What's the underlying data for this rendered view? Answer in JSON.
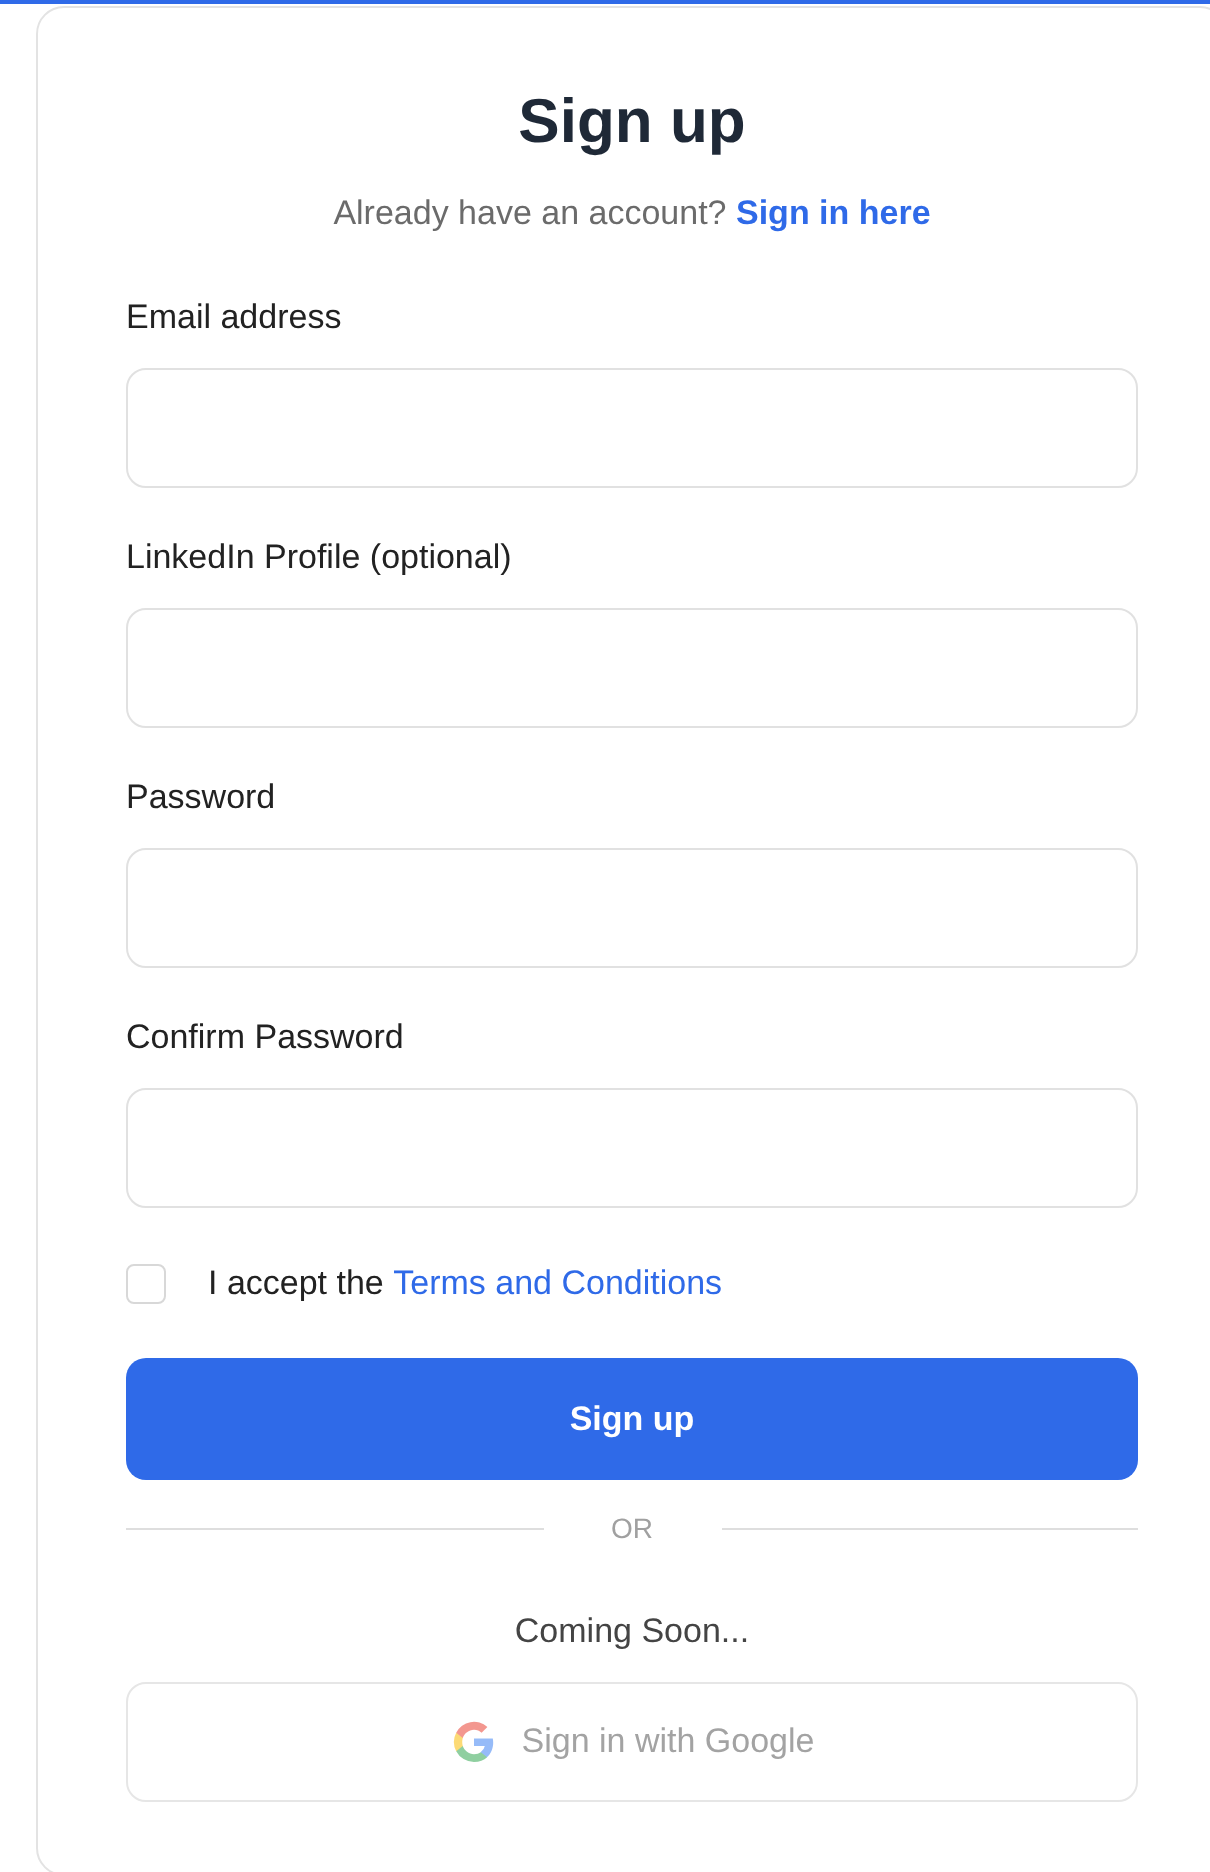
{
  "title": "Sign up",
  "signin_prompt": {
    "text": "Already have an account?",
    "link": "Sign in here"
  },
  "fields": [
    {
      "label": "Email address"
    },
    {
      "label": "LinkedIn Profile (optional)"
    },
    {
      "label": "Password"
    },
    {
      "label": "Confirm Password"
    }
  ],
  "terms": {
    "checked": false,
    "text": "I accept the",
    "link": "Terms and Conditions"
  },
  "submit_button": "Sign up",
  "divider": "OR",
  "coming_soon": "Coming Soon...",
  "google_button": {
    "label": "Sign in with Google",
    "disabled": true
  }
}
